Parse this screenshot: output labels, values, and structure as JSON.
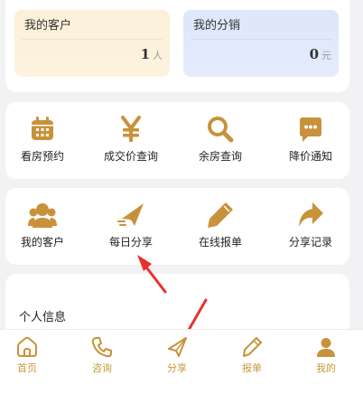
{
  "colors": {
    "accent": "#c8923a",
    "tab_label": "#c89a3c",
    "arrow": "#e8312f"
  },
  "stats": {
    "customers": {
      "label": "我的客户",
      "value": "1",
      "unit": "人"
    },
    "distribution": {
      "label": "我的分销",
      "value": "0",
      "unit": "元"
    }
  },
  "menu1": [
    {
      "label": "看房预约",
      "icon": "calendar-icon"
    },
    {
      "label": "成交价查询",
      "icon": "yen-icon"
    },
    {
      "label": "余房查询",
      "icon": "search-icon"
    },
    {
      "label": "降价通知",
      "icon": "chat-bubble-icon"
    }
  ],
  "menu2": [
    {
      "label": "我的客户",
      "icon": "users-icon"
    },
    {
      "label": "每日分享",
      "icon": "paper-plane-icon"
    },
    {
      "label": "在线报单",
      "icon": "pen-icon"
    },
    {
      "label": "分享记录",
      "icon": "share-arrow-icon"
    }
  ],
  "info": {
    "title": "个人信息"
  },
  "tabbar": [
    {
      "label": "首页",
      "icon": "home-icon"
    },
    {
      "label": "咨询",
      "icon": "phone-icon"
    },
    {
      "label": "分享",
      "icon": "paper-plane-icon"
    },
    {
      "label": "报单",
      "icon": "pen-icon"
    },
    {
      "label": "我的",
      "icon": "user-icon"
    }
  ]
}
